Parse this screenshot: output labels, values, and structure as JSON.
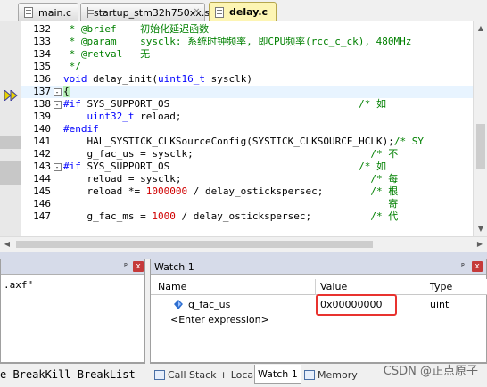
{
  "tabs": [
    {
      "label": "main.c",
      "active": false
    },
    {
      "label": "startup_stm32h750xx.s",
      "active": false
    },
    {
      "label": "delay.c",
      "active": true
    }
  ],
  "code_lines": [
    {
      "num": "132",
      "fold": "",
      "parts": [
        [
          "c-cmt",
          " * @brief    初始化延迟函数"
        ]
      ]
    },
    {
      "num": "133",
      "fold": "",
      "parts": [
        [
          "c-cmt",
          " * @param    sysclk: 系统时钟频率, 即CPU频率(rcc_c_ck), 480MHz"
        ]
      ]
    },
    {
      "num": "134",
      "fold": "",
      "parts": [
        [
          "c-cmt",
          " * @retval   无"
        ]
      ]
    },
    {
      "num": "135",
      "fold": "",
      "parts": [
        [
          "c-cmt",
          " */"
        ]
      ]
    },
    {
      "num": "136",
      "fold": "",
      "parts": [
        [
          "c-kw",
          "void"
        ],
        [
          "c-txt",
          " delay_init("
        ],
        [
          "c-kw",
          "uint16_t"
        ],
        [
          "c-txt",
          " sysclk)"
        ]
      ]
    },
    {
      "num": "137",
      "fold": "-",
      "current": true,
      "parts": [
        [
          "c-bracket",
          "{"
        ]
      ]
    },
    {
      "num": "138",
      "fold": "-",
      "parts": [
        [
          "c-pp",
          "#if"
        ],
        [
          "c-txt",
          " SYS_SUPPORT_OS                                "
        ],
        [
          "c-cmt",
          "/* 如"
        ]
      ]
    },
    {
      "num": "139",
      "fold": "",
      "parts": [
        [
          "c-txt",
          "    "
        ],
        [
          "c-kw",
          "uint32_t"
        ],
        [
          "c-txt",
          " reload;"
        ]
      ]
    },
    {
      "num": "140",
      "fold": "",
      "parts": [
        [
          "c-pp",
          "#endif"
        ]
      ]
    },
    {
      "num": "141",
      "fold": "",
      "parts": [
        [
          "c-txt",
          "    HAL_SYSTICK_CLKSourceConfig(SYSTICK_CLKSOURCE_HCLK);"
        ],
        [
          "c-cmt",
          "/* SY"
        ]
      ]
    },
    {
      "num": "142",
      "fold": "",
      "parts": [
        [
          "c-txt",
          "    g_fac_us = sysclk;                              "
        ],
        [
          "c-cmt",
          "/* 不"
        ]
      ]
    },
    {
      "num": "143",
      "fold": "-",
      "parts": [
        [
          "c-pp",
          "#if"
        ],
        [
          "c-txt",
          " SYS_SUPPORT_OS                                "
        ],
        [
          "c-cmt",
          "/* 如"
        ]
      ]
    },
    {
      "num": "144",
      "fold": "",
      "parts": [
        [
          "c-txt",
          "    reload = sysclk;                                "
        ],
        [
          "c-cmt",
          "/* 每"
        ]
      ]
    },
    {
      "num": "145",
      "fold": "",
      "parts": [
        [
          "c-txt",
          "    reload *= "
        ],
        [
          "c-num",
          "1000000"
        ],
        [
          "c-txt",
          " / delay_ostickspersec;        "
        ],
        [
          "c-cmt",
          "/* 根"
        ]
      ]
    },
    {
      "num": "146",
      "fold": "",
      "parts": [
        [
          "c-txt",
          "                                                    "
        ],
        [
          "c-cmt",
          "   寄"
        ]
      ]
    },
    {
      "num": "147",
      "fold": "",
      "parts": [
        [
          "c-txt",
          "    g_fac_ms = "
        ],
        [
          "c-num",
          "1000"
        ],
        [
          "c-txt",
          " / delay_ostickspersec;          "
        ],
        [
          "c-cmt",
          "/* 代"
        ]
      ]
    }
  ],
  "left_pane": {
    "text": ".axf\"",
    "pin": "ᵖ",
    "close": "x"
  },
  "watch": {
    "title": "Watch 1",
    "pin": "ᵖ",
    "close": "x",
    "columns": [
      "Name",
      "Value",
      "Type"
    ],
    "rows": [
      {
        "name": "g_fac_us",
        "value": "0x00000000",
        "type": "uint"
      },
      {
        "name": "<Enter expression>",
        "value": "",
        "type": ""
      }
    ]
  },
  "bottom_left_tabs": "e BreakKill BreakList",
  "bottom_tabs": [
    {
      "label": "Call Stack + Locals",
      "active": false
    },
    {
      "label": "Watch 1",
      "active": true
    },
    {
      "label": "Memory",
      "active": false
    }
  ],
  "watermark": "CSDN @正点原子",
  "colors": {
    "highlight_box": "#e8322f",
    "current_line_bracket": "#b6f0b6",
    "active_tab": "#fdf5b4"
  }
}
